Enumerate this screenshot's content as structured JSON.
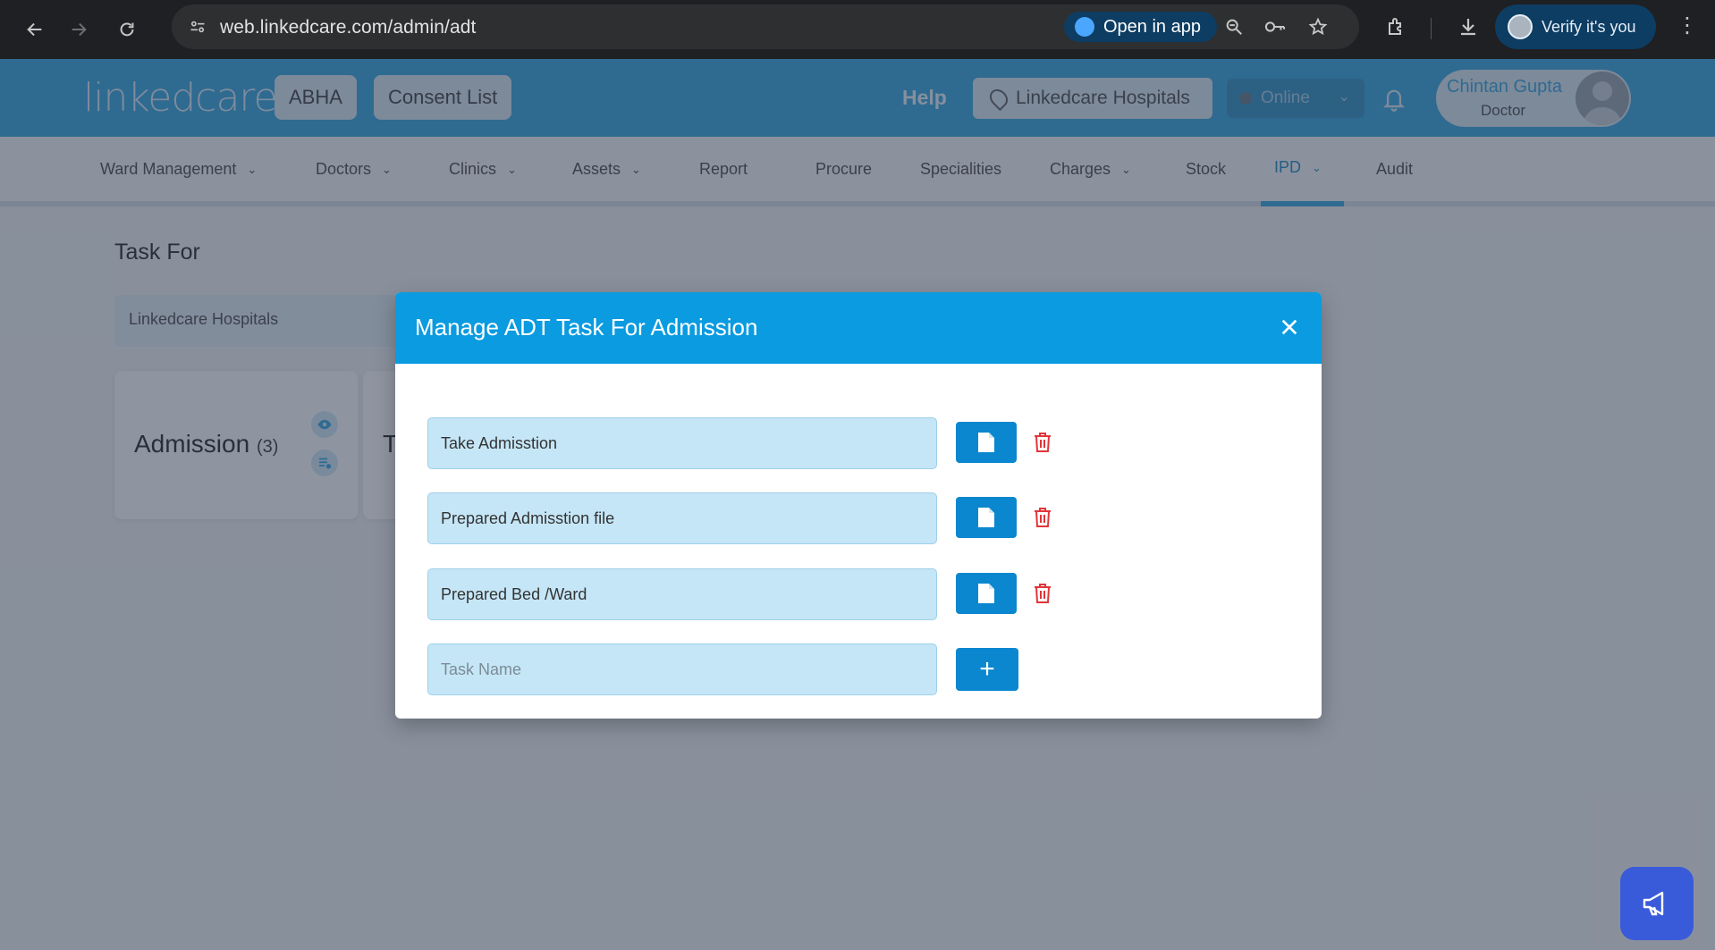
{
  "browser": {
    "url": "web.linkedcare.com/admin/adt",
    "open_in_app": "Open in app",
    "verify": "Verify it's you"
  },
  "header": {
    "logo": "linkedcare",
    "abha": "ABHA",
    "consent_list": "Consent List",
    "help": "Help",
    "hospital": "Linkedcare Hospitals",
    "status": "Online",
    "user_name": "Chintan Gupta",
    "user_role": "Doctor"
  },
  "menu": {
    "items": [
      {
        "label": "Ward Management"
      },
      {
        "label": "Doctors"
      },
      {
        "label": "Clinics"
      },
      {
        "label": "Assets"
      },
      {
        "label": "Report"
      },
      {
        "label": "Procure"
      },
      {
        "label": "Specialities"
      },
      {
        "label": "Charges"
      },
      {
        "label": "Stock"
      },
      {
        "label": "IPD"
      },
      {
        "label": "Audit"
      }
    ]
  },
  "page": {
    "title": "Task For",
    "hospital_field": "Linkedcare Hospitals",
    "card_admission": {
      "title": "Admission",
      "count": "(3)"
    },
    "card_partial": "Tı"
  },
  "modal": {
    "title": "Manage ADT Task For Admission",
    "tasks": [
      {
        "value": "Take Admisstion"
      },
      {
        "value": "Prepared Admisstion file"
      },
      {
        "value": "Prepared Bed /Ward"
      }
    ],
    "new_task_placeholder": "Task Name",
    "add_label": "+"
  },
  "colors": {
    "header_blue": "#3fa8e0",
    "modal_header": "#0a9be0",
    "button_blue": "#0a87cf",
    "trash_red": "#e0353a",
    "announce": "#3a5bd9"
  }
}
